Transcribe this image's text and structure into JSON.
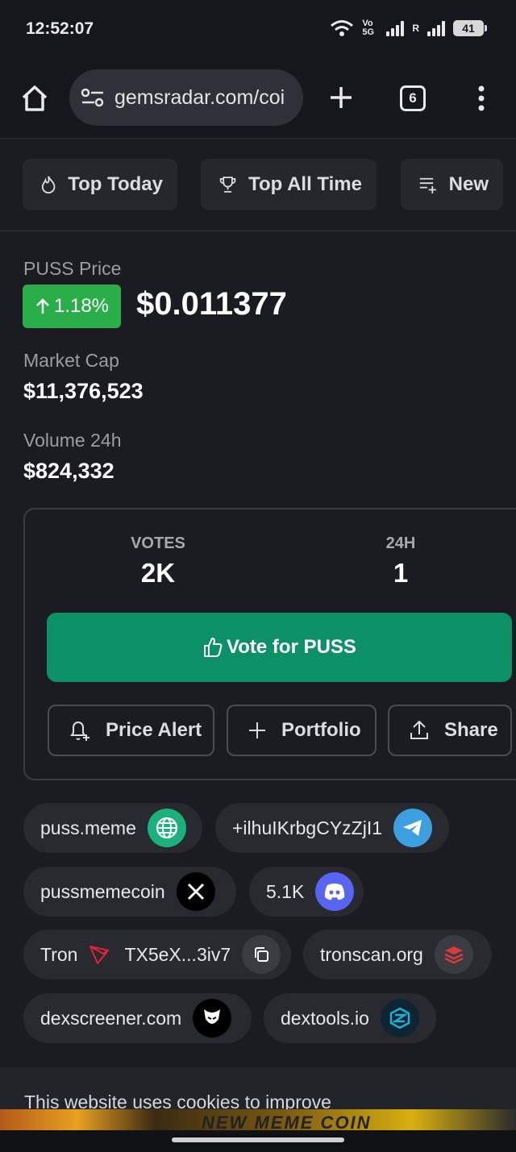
{
  "status_bar": {
    "time": "12:52:07",
    "network": "Vo 5G",
    "roaming": "R",
    "battery": "41"
  },
  "browser": {
    "url": "gemsradar.com/coi",
    "tab_count": "6"
  },
  "categories": [
    {
      "label": "Top Today",
      "icon": "flame-icon"
    },
    {
      "label": "Top All Time",
      "icon": "trophy-icon"
    },
    {
      "label": "New",
      "icon": "list-add-icon"
    }
  ],
  "coin": {
    "price_label": "PUSS Price",
    "change": "1.18%",
    "price": "$0.011377",
    "market_cap_label": "Market Cap",
    "market_cap": "$11,376,523",
    "volume_label": "Volume 24h",
    "volume": "$824,332"
  },
  "votes": {
    "votes_label": "VOTES",
    "votes_value": "2K",
    "h24_label": "24H",
    "h24_value": "1",
    "vote_button": "Vote for PUSS",
    "price_alert": "Price Alert",
    "portfolio": "Portfolio",
    "share": "Share"
  },
  "links": {
    "website": "puss.meme",
    "telegram": "+ilhuIKrbgCYzZjI1",
    "twitter": "pussmemecoin",
    "discord": "5.1K",
    "chain": "Tron",
    "contract": "TX5eX...3iv7",
    "tronscan": "tronscan.org",
    "dexscreener": "dexscreener.com",
    "dextools": "dextools.io"
  },
  "cookie_text": "This website uses cookies to improve",
  "ad_text": "NEW MEME COIN",
  "colors": {
    "green_badge": "#2aae4a",
    "vote_button": "#0c9166",
    "background": "#1a1c21"
  }
}
